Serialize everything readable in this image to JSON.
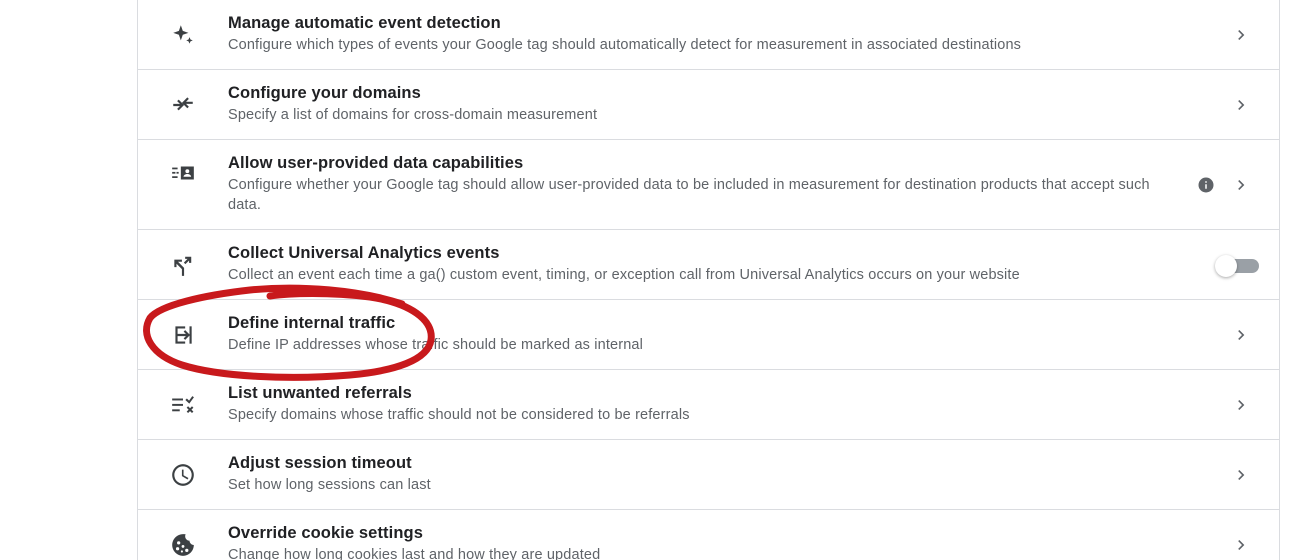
{
  "settings": {
    "items": [
      {
        "title": "Manage automatic event detection",
        "description": "Configure which types of events your Google tag should automatically detect for measurement in associated destinations",
        "icon": "sparkle-icon",
        "control": "chevron"
      },
      {
        "title": "Configure your domains",
        "description": "Specify a list of domains for cross-domain measurement",
        "icon": "merge-arrows-icon",
        "control": "chevron"
      },
      {
        "title": "Allow user-provided data capabilities",
        "description": "Configure whether your Google tag should allow user-provided data to be included in measurement for destination products that accept such data.",
        "icon": "contact-data-icon",
        "control": "chevron",
        "has_info": true
      },
      {
        "title": "Collect Universal Analytics events",
        "description": "Collect an event each time a ga() custom event, timing, or exception call from Universal Analytics occurs on your website",
        "icon": "fork-arrow-icon",
        "control": "toggle",
        "toggle_on": false
      },
      {
        "title": "Define internal traffic",
        "description": "Define IP addresses whose traffic should be marked as internal",
        "icon": "login-arrow-icon",
        "control": "chevron"
      },
      {
        "title": "List unwanted referrals",
        "description": "Specify domains whose traffic should not be considered to be referrals",
        "icon": "list-remove-icon",
        "control": "chevron"
      },
      {
        "title": "Adjust session timeout",
        "description": "Set how long sessions can last",
        "icon": "clock-icon",
        "control": "chevron"
      },
      {
        "title": "Override cookie settings",
        "description": "Change how long cookies last and how they are updated",
        "icon": "cookie-icon",
        "control": "chevron"
      }
    ]
  },
  "colors": {
    "annotation": "#c8191c",
    "divider": "#dadce0",
    "title_text": "#202124",
    "desc_text": "#5f6368"
  }
}
